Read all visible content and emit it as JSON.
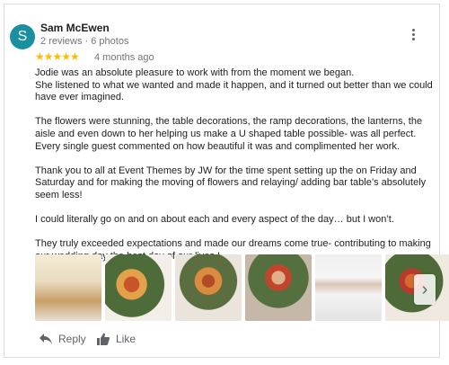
{
  "review": {
    "avatar_letter": "S",
    "avatar_color": "#1a8fa0",
    "author": "Sam McEwen",
    "author_meta": "2 reviews · 6 photos",
    "stars": "★★★★★",
    "rating": 5,
    "time_ago": "4 months ago",
    "paragraphs": [
      "Jodie was an absolute pleasure to work with from the moment we began.\nShe listened to what we wanted and made it happen, and it turned out better than we could have ever imagined.",
      "The flowers were stunning, the table decorations, the ramp decorations, the lanterns, the aisle and even down to her helping us make a U shaped table possible- was all perfect.\nEvery single guest commented on how beautiful it was and complimented her work.",
      "Thank you to all at Event Themes by JW  for the time spent setting up the on Friday and Saturday and for making the moving of flowers and relaying/ adding bar table’s absolutely seem less!",
      "I could literally go on and on about each and every aspect of the day…  but I won’t.",
      "They truly exceeded expectations and made our dreams come true- contributing to making our wedding day the best day of our lives  !"
    ],
    "next_arrow": "›",
    "actions": {
      "reply_label": "Reply",
      "like_label": "Like"
    },
    "icons": {
      "menu": "more-vert-icon",
      "reply": "reply-arrow-icon",
      "like": "thumbs-up-icon",
      "next": "chevron-right-icon"
    },
    "colors": {
      "star": "#fbbc04",
      "secondary_text": "#70757a"
    }
  }
}
